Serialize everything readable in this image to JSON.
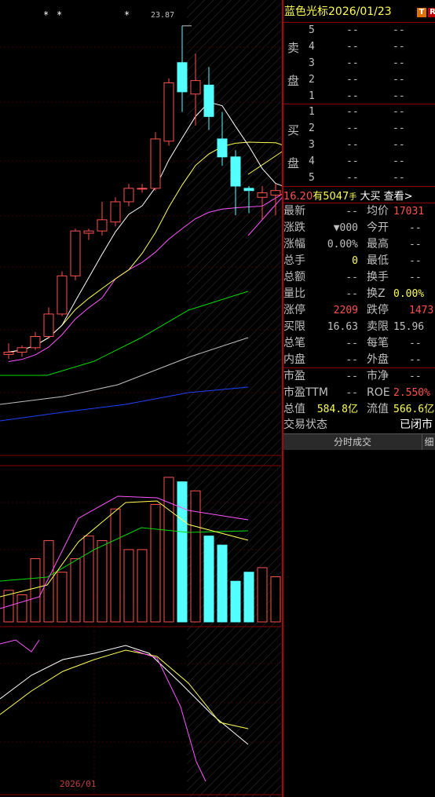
{
  "chart": {
    "peak_label": "23.87",
    "star_glyph": "*",
    "date_label": "2026/01",
    "colors": {
      "up": "#ff5050",
      "down": "#54ffff",
      "ma5": "#ffffff",
      "ma10": "#ffff54",
      "ma20": "#ff54ff",
      "ma60": "#00dd00",
      "ma120": "#c0c0c0",
      "ma250": "#2040ff"
    }
  },
  "chart_data": [
    {
      "type": "candlestick",
      "title": "",
      "candles": [
        {
          "o": 16.55,
          "h": 16.8,
          "l": 16.45,
          "c": 16.6
        },
        {
          "o": 16.6,
          "h": 16.75,
          "l": 16.5,
          "c": 16.7
        },
        {
          "o": 16.7,
          "h": 17.05,
          "l": 16.65,
          "c": 16.95
        },
        {
          "o": 16.95,
          "h": 17.6,
          "l": 16.9,
          "c": 17.45
        },
        {
          "o": 17.45,
          "h": 18.4,
          "l": 17.4,
          "c": 18.3
        },
        {
          "o": 18.3,
          "h": 19.35,
          "l": 18.2,
          "c": 19.3
        },
        {
          "o": 19.25,
          "h": 19.35,
          "l": 19.1,
          "c": 19.3
        },
        {
          "o": 19.3,
          "h": 19.95,
          "l": 19.2,
          "c": 19.55
        },
        {
          "o": 19.5,
          "h": 20.05,
          "l": 19.4,
          "c": 19.95
        },
        {
          "o": 19.95,
          "h": 20.35,
          "l": 19.85,
          "c": 20.25
        },
        {
          "o": 20.25,
          "h": 20.35,
          "l": 20.15,
          "c": 20.25
        },
        {
          "o": 20.25,
          "h": 21.5,
          "l": 20.2,
          "c": 21.35
        },
        {
          "o": 21.3,
          "h": 22.7,
          "l": 21.2,
          "c": 22.6
        },
        {
          "o": 23.05,
          "h": 23.87,
          "l": 21.95,
          "c": 22.4
        },
        {
          "o": 22.35,
          "h": 23.25,
          "l": 21.65,
          "c": 22.65
        },
        {
          "o": 22.55,
          "h": 22.95,
          "l": 21.55,
          "c": 21.85
        },
        {
          "o": 21.35,
          "h": 21.95,
          "l": 20.75,
          "c": 20.95
        },
        {
          "o": 20.95,
          "h": 21.1,
          "l": 19.65,
          "c": 20.3
        },
        {
          "o": 20.25,
          "h": 20.3,
          "l": 19.7,
          "c": 20.2
        },
        {
          "o": 20.05,
          "h": 20.3,
          "l": 19.55,
          "c": 20.15
        },
        {
          "o": 20.1,
          "h": 20.35,
          "l": 19.65,
          "c": 20.2
        },
        {
          "o": 20.1,
          "h": 20.65,
          "l": 19.8,
          "c": 20.4
        }
      ],
      "ma_series": [
        {
          "name": "",
          "color": "ma5"
        },
        {
          "name": "",
          "color": "ma10"
        },
        {
          "name": "",
          "color": "ma20"
        },
        {
          "name": "",
          "color": "ma60"
        },
        {
          "name": "",
          "color": "ma120"
        },
        {
          "name": "",
          "color": "ma250"
        }
      ]
    },
    {
      "type": "bar",
      "title": "",
      "volumes": [
        14,
        12,
        28,
        36,
        22,
        28,
        38,
        36,
        50,
        32,
        32,
        52,
        64,
        62,
        58,
        38,
        34,
        18,
        22,
        24,
        20,
        26
      ]
    }
  ],
  "header": {
    "stock_name": "蓝色光标",
    "date": "2026/01/23",
    "badge1": "T",
    "badge2": "R"
  },
  "order_book": {
    "sell_label_1": "卖",
    "sell_label_2": "盘",
    "buy_label_1": "买",
    "buy_label_2": "盘",
    "sell": [
      {
        "level": "5",
        "price": "--",
        "vol": "--"
      },
      {
        "level": "4",
        "price": "--",
        "vol": "--"
      },
      {
        "level": "3",
        "price": "--",
        "vol": "--"
      },
      {
        "level": "2",
        "price": "--",
        "vol": "--"
      },
      {
        "level": "1",
        "price": "--",
        "vol": "--"
      }
    ],
    "buy": [
      {
        "level": "1",
        "price": "--",
        "vol": "--"
      },
      {
        "level": "2",
        "price": "--",
        "vol": "--"
      },
      {
        "level": "3",
        "price": "--",
        "vol": "--"
      },
      {
        "level": "4",
        "price": "--",
        "vol": "--"
      },
      {
        "level": "5",
        "price": "--",
        "vol": "--"
      }
    ]
  },
  "summary": {
    "price": "16.20",
    "has": "有",
    "vol": "5047",
    "unit": "手",
    "big": "大买",
    "view": "查看>"
  },
  "quote_rows": [
    {
      "l1": "最新",
      "v1": "--",
      "l2": "均价",
      "v2": "17031",
      "c1": "#c0c0c0",
      "c2": "#ff5050"
    },
    {
      "l1": "涨跌",
      "v1": "▼000",
      "l2": "今开",
      "v2": "--",
      "c1": "#c0c0c0",
      "c2": "#c0c0c0"
    },
    {
      "l1": "涨幅",
      "v1": "0.00%",
      "l2": "最高",
      "v2": "--",
      "c1": "#c0c0c0",
      "c2": "#c0c0c0"
    },
    {
      "l1": "总手",
      "v1": "0",
      "l2": "最低",
      "v2": "--",
      "c1": "#ffff54",
      "c2": "#c0c0c0"
    },
    {
      "l1": "总额",
      "v1": "--",
      "l2": "换手",
      "v2": "--",
      "c1": "#c0c0c0",
      "c2": "#c0c0c0"
    },
    {
      "l1": "量比",
      "v1": "--",
      "l2": "换Z",
      "v2": "0.00%",
      "c1": "#c0c0c0",
      "c2": "#ffff54"
    },
    {
      "l1": "涨停",
      "v1": "2209",
      "l2": "跌停",
      "v2": "1473",
      "c1": "#ff5050",
      "c2": "#ff5050"
    },
    {
      "l1": "买限",
      "v1": "16.63",
      "l2": "卖限",
      "v2": "15.96",
      "c1": "#c0c0c0",
      "c2": "#c0c0c0"
    },
    {
      "l1": "总笔",
      "v1": "--",
      "l2": "每笔",
      "v2": "--",
      "c1": "#c0c0c0",
      "c2": "#c0c0c0"
    },
    {
      "l1": "内盘",
      "v1": "--",
      "l2": "外盘",
      "v2": "--",
      "c1": "#c0c0c0",
      "c2": "#c0c0c0"
    }
  ],
  "valuation": [
    {
      "l1": "市盈",
      "v1": "--",
      "l2": "市净",
      "v2": "--",
      "c1": "#c0c0c0",
      "c2": "#c0c0c0"
    },
    {
      "l1": "市盈TTM",
      "v1": "--",
      "l2": "ROE",
      "v2": "2.550%",
      "c1": "#c0c0c0",
      "c2": "#ff5050"
    },
    {
      "l1": "总值",
      "v1": "584.8亿",
      "l2": "流值",
      "v2": "566.6亿",
      "c1": "#ffff54",
      "c2": "#ffff54"
    }
  ],
  "trade_status": {
    "label": "交易状态",
    "value": "已闭市"
  },
  "tabs": {
    "tab1": "分时成交",
    "tab2": "细"
  }
}
